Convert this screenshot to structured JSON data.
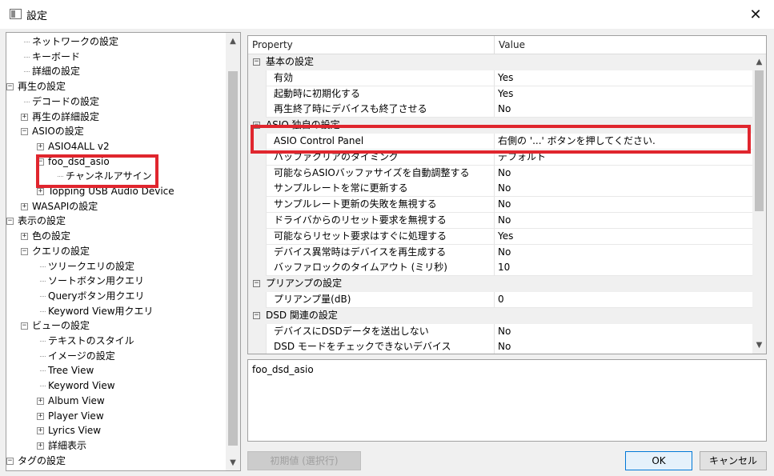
{
  "window": {
    "title": "設定"
  },
  "tree": [
    {
      "label": "ネットワークの設定",
      "level": 2,
      "expander": "none"
    },
    {
      "label": "キーボード",
      "level": 2,
      "expander": "none"
    },
    {
      "label": "詳細の設定",
      "level": 2,
      "expander": "none"
    },
    {
      "label": "再生の設定",
      "level": 1,
      "expander": "minus"
    },
    {
      "label": "デコードの設定",
      "level": 2,
      "expander": "none"
    },
    {
      "label": "再生の詳細設定",
      "level": 2,
      "expander": "plus"
    },
    {
      "label": "ASIOの設定",
      "level": 2,
      "expander": "minus"
    },
    {
      "label": "ASIO4ALL v2",
      "level": 3,
      "expander": "plus"
    },
    {
      "label": "foo_dsd_asio",
      "level": 3,
      "expander": "minus"
    },
    {
      "label": "チャンネルアサイン",
      "level": 4,
      "expander": "none"
    },
    {
      "label": "Topping USB Audio Device",
      "level": 3,
      "expander": "plus"
    },
    {
      "label": "WASAPIの設定",
      "level": 2,
      "expander": "plus"
    },
    {
      "label": "表示の設定",
      "level": 1,
      "expander": "minus"
    },
    {
      "label": "色の設定",
      "level": 2,
      "expander": "plus"
    },
    {
      "label": "クエリの設定",
      "level": 2,
      "expander": "minus"
    },
    {
      "label": "ツリークエリの設定",
      "level": 3,
      "expander": "none"
    },
    {
      "label": "ソートボタン用クエリ",
      "level": 3,
      "expander": "none"
    },
    {
      "label": "Queryボタン用クエリ",
      "level": 3,
      "expander": "none"
    },
    {
      "label": "Keyword View用クエリ",
      "level": 3,
      "expander": "none"
    },
    {
      "label": "ビューの設定",
      "level": 2,
      "expander": "minus"
    },
    {
      "label": "テキストのスタイル",
      "level": 3,
      "expander": "none"
    },
    {
      "label": "イメージの設定",
      "level": 3,
      "expander": "none"
    },
    {
      "label": "Tree View",
      "level": 3,
      "expander": "none"
    },
    {
      "label": "Keyword View",
      "level": 3,
      "expander": "none"
    },
    {
      "label": "Album View",
      "level": 3,
      "expander": "plus"
    },
    {
      "label": "Player View",
      "level": 3,
      "expander": "plus"
    },
    {
      "label": "Lyrics View",
      "level": 3,
      "expander": "plus"
    },
    {
      "label": "詳細表示",
      "level": 3,
      "expander": "plus"
    },
    {
      "label": "タグの設定",
      "level": 1,
      "expander": "minus"
    }
  ],
  "grid": {
    "header": {
      "property": "Property",
      "value": "Value"
    },
    "rows": [
      {
        "type": "category",
        "label": "基本の設定"
      },
      {
        "type": "prop",
        "name": "有効",
        "value": "Yes"
      },
      {
        "type": "prop",
        "name": "起動時に初期化する",
        "value": "Yes"
      },
      {
        "type": "prop",
        "name": "再生終了時にデバイスも終了させる",
        "value": "No"
      },
      {
        "type": "category",
        "label": "ASIO 独自の設定"
      },
      {
        "type": "prop",
        "name": "ASIO Control Panel",
        "value": "右側の '...' ボタンを押してください."
      },
      {
        "type": "prop",
        "name": "バッファクリアのタイミング",
        "value": "デフォルト"
      },
      {
        "type": "prop",
        "name": "可能ならASIOバッファサイズを自動調整する",
        "value": "No"
      },
      {
        "type": "prop",
        "name": "サンプルレートを常に更新する",
        "value": "No"
      },
      {
        "type": "prop",
        "name": "サンプルレート更新の失敗を無視する",
        "value": "No"
      },
      {
        "type": "prop",
        "name": "ドライバからのリセット要求を無視する",
        "value": "No"
      },
      {
        "type": "prop",
        "name": "可能ならリセット要求はすぐに処理する",
        "value": "Yes"
      },
      {
        "type": "prop",
        "name": "デバイス異常時はデバイスを再生成する",
        "value": "No"
      },
      {
        "type": "prop",
        "name": "バッファロックのタイムアウト (ミリ秒)",
        "value": "10"
      },
      {
        "type": "category",
        "label": "プリアンプの設定"
      },
      {
        "type": "prop",
        "name": "プリアンプ量(dB)",
        "value": "0"
      },
      {
        "type": "category",
        "label": "DSD 関連の設定"
      },
      {
        "type": "prop",
        "name": "デバイスにDSDデータを送出しない",
        "value": "No"
      },
      {
        "type": "prop",
        "name": "DSD モードをチェックできないデバイス",
        "value": "No"
      }
    ]
  },
  "description": "foo_dsd_asio",
  "buttons": {
    "reset": "初期値 (選択行)",
    "ok": "OK",
    "cancel": "キャンセル"
  },
  "highlight_color": "#e0262e"
}
